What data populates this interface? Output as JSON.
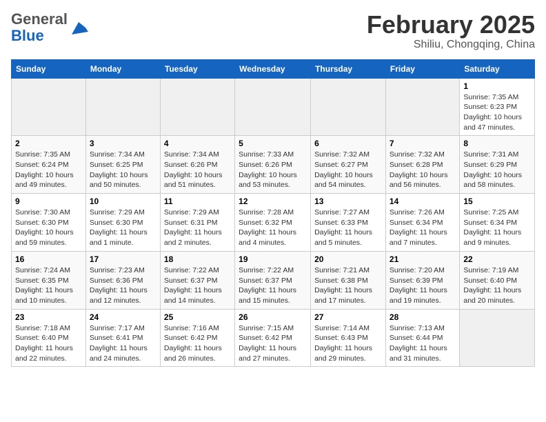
{
  "header": {
    "logo_general": "General",
    "logo_blue": "Blue",
    "month_title": "February 2025",
    "subtitle": "Shiliu, Chongqing, China"
  },
  "weekdays": [
    "Sunday",
    "Monday",
    "Tuesday",
    "Wednesday",
    "Thursday",
    "Friday",
    "Saturday"
  ],
  "weeks": [
    [
      {
        "day": "",
        "info": ""
      },
      {
        "day": "",
        "info": ""
      },
      {
        "day": "",
        "info": ""
      },
      {
        "day": "",
        "info": ""
      },
      {
        "day": "",
        "info": ""
      },
      {
        "day": "",
        "info": ""
      },
      {
        "day": "1",
        "info": "Sunrise: 7:35 AM\nSunset: 6:23 PM\nDaylight: 10 hours and 47 minutes."
      }
    ],
    [
      {
        "day": "2",
        "info": "Sunrise: 7:35 AM\nSunset: 6:24 PM\nDaylight: 10 hours and 49 minutes."
      },
      {
        "day": "3",
        "info": "Sunrise: 7:34 AM\nSunset: 6:25 PM\nDaylight: 10 hours and 50 minutes."
      },
      {
        "day": "4",
        "info": "Sunrise: 7:34 AM\nSunset: 6:26 PM\nDaylight: 10 hours and 51 minutes."
      },
      {
        "day": "5",
        "info": "Sunrise: 7:33 AM\nSunset: 6:26 PM\nDaylight: 10 hours and 53 minutes."
      },
      {
        "day": "6",
        "info": "Sunrise: 7:32 AM\nSunset: 6:27 PM\nDaylight: 10 hours and 54 minutes."
      },
      {
        "day": "7",
        "info": "Sunrise: 7:32 AM\nSunset: 6:28 PM\nDaylight: 10 hours and 56 minutes."
      },
      {
        "day": "8",
        "info": "Sunrise: 7:31 AM\nSunset: 6:29 PM\nDaylight: 10 hours and 58 minutes."
      }
    ],
    [
      {
        "day": "9",
        "info": "Sunrise: 7:30 AM\nSunset: 6:30 PM\nDaylight: 10 hours and 59 minutes."
      },
      {
        "day": "10",
        "info": "Sunrise: 7:29 AM\nSunset: 6:30 PM\nDaylight: 11 hours and 1 minute."
      },
      {
        "day": "11",
        "info": "Sunrise: 7:29 AM\nSunset: 6:31 PM\nDaylight: 11 hours and 2 minutes."
      },
      {
        "day": "12",
        "info": "Sunrise: 7:28 AM\nSunset: 6:32 PM\nDaylight: 11 hours and 4 minutes."
      },
      {
        "day": "13",
        "info": "Sunrise: 7:27 AM\nSunset: 6:33 PM\nDaylight: 11 hours and 5 minutes."
      },
      {
        "day": "14",
        "info": "Sunrise: 7:26 AM\nSunset: 6:34 PM\nDaylight: 11 hours and 7 minutes."
      },
      {
        "day": "15",
        "info": "Sunrise: 7:25 AM\nSunset: 6:34 PM\nDaylight: 11 hours and 9 minutes."
      }
    ],
    [
      {
        "day": "16",
        "info": "Sunrise: 7:24 AM\nSunset: 6:35 PM\nDaylight: 11 hours and 10 minutes."
      },
      {
        "day": "17",
        "info": "Sunrise: 7:23 AM\nSunset: 6:36 PM\nDaylight: 11 hours and 12 minutes."
      },
      {
        "day": "18",
        "info": "Sunrise: 7:22 AM\nSunset: 6:37 PM\nDaylight: 11 hours and 14 minutes."
      },
      {
        "day": "19",
        "info": "Sunrise: 7:22 AM\nSunset: 6:37 PM\nDaylight: 11 hours and 15 minutes."
      },
      {
        "day": "20",
        "info": "Sunrise: 7:21 AM\nSunset: 6:38 PM\nDaylight: 11 hours and 17 minutes."
      },
      {
        "day": "21",
        "info": "Sunrise: 7:20 AM\nSunset: 6:39 PM\nDaylight: 11 hours and 19 minutes."
      },
      {
        "day": "22",
        "info": "Sunrise: 7:19 AM\nSunset: 6:40 PM\nDaylight: 11 hours and 20 minutes."
      }
    ],
    [
      {
        "day": "23",
        "info": "Sunrise: 7:18 AM\nSunset: 6:40 PM\nDaylight: 11 hours and 22 minutes."
      },
      {
        "day": "24",
        "info": "Sunrise: 7:17 AM\nSunset: 6:41 PM\nDaylight: 11 hours and 24 minutes."
      },
      {
        "day": "25",
        "info": "Sunrise: 7:16 AM\nSunset: 6:42 PM\nDaylight: 11 hours and 26 minutes."
      },
      {
        "day": "26",
        "info": "Sunrise: 7:15 AM\nSunset: 6:42 PM\nDaylight: 11 hours and 27 minutes."
      },
      {
        "day": "27",
        "info": "Sunrise: 7:14 AM\nSunset: 6:43 PM\nDaylight: 11 hours and 29 minutes."
      },
      {
        "day": "28",
        "info": "Sunrise: 7:13 AM\nSunset: 6:44 PM\nDaylight: 11 hours and 31 minutes."
      },
      {
        "day": "",
        "info": ""
      }
    ]
  ]
}
